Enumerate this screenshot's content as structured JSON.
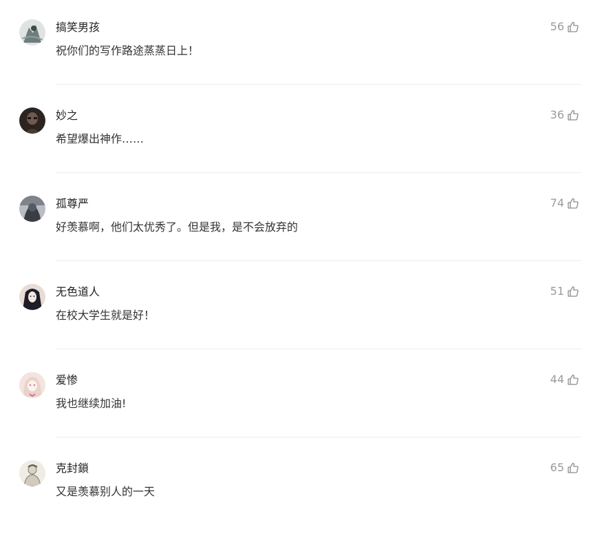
{
  "comments": [
    {
      "author": "搞笑男孩",
      "text": "祝你们的写作路途蒸蒸日上！",
      "likes": "56",
      "avatar_icon": "ink-figure-avatar",
      "avatar_colors": [
        "#5c6b6e",
        "#dfe4e2"
      ]
    },
    {
      "author": "妙之",
      "text": "希望爆出神作……",
      "likes": "36",
      "avatar_icon": "dark-portrait-avatar",
      "avatar_colors": [
        "#2b2421",
        "#6e5a4e"
      ]
    },
    {
      "author": "孤尊严",
      "text": "好羡慕啊，他们太优秀了。但是我，是不会放弃的",
      "likes": "74",
      "avatar_icon": "grey-silhouette-avatar",
      "avatar_colors": [
        "#3a3d44",
        "#b9bcc3"
      ]
    },
    {
      "author": "无色道人",
      "text": "在校大学生就是好！",
      "likes": "51",
      "avatar_icon": "anime-girl-avatar",
      "avatar_colors": [
        "#1e1c24",
        "#e7dcd6"
      ]
    },
    {
      "author": "爱惨",
      "text": "我也继续加油!",
      "likes": "44",
      "avatar_icon": "pink-anime-avatar",
      "avatar_colors": [
        "#f3e4e0",
        "#c7768a"
      ]
    },
    {
      "author": "克封鎖",
      "text": "又是羡慕别人的一天",
      "likes": "65",
      "avatar_icon": "sketch-figure-avatar",
      "avatar_colors": [
        "#efece4",
        "#7b7a70"
      ]
    }
  ],
  "colors": {
    "author": "#222222",
    "text": "#333333",
    "likes": "#9a9a9a",
    "divider": "#ededed"
  },
  "like_icon": "thumb-up-icon"
}
